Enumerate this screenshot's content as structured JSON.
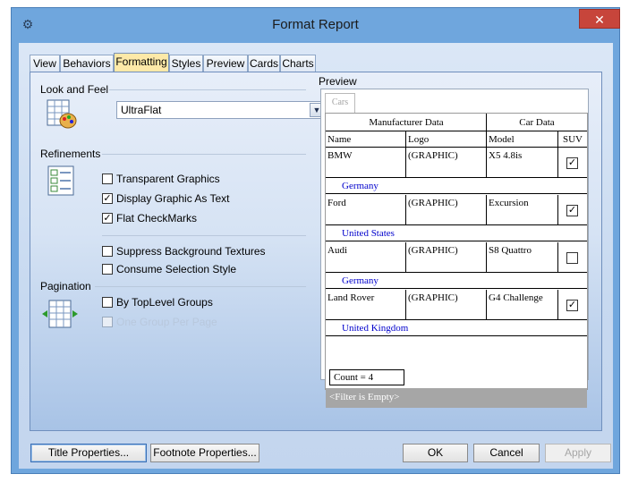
{
  "window": {
    "title": "Format Report",
    "close_glyph": "✕"
  },
  "tabs": [
    {
      "label": "View"
    },
    {
      "label": "Behaviors"
    },
    {
      "label": "Formatting"
    },
    {
      "label": "Styles"
    },
    {
      "label": "Preview"
    },
    {
      "label": "Cards"
    },
    {
      "label": "Charts"
    }
  ],
  "look_and_feel": {
    "heading": "Look and Feel",
    "combo_value": "UltraFlat",
    "icon": "palette-grid-icon"
  },
  "refinements": {
    "heading": "Refinements",
    "icon": "grid-checkboxes-icon",
    "options": [
      {
        "label": "Transparent Graphics",
        "checked": false
      },
      {
        "label": "Display Graphic As Text",
        "checked": true
      },
      {
        "label": "Flat CheckMarks",
        "checked": true
      },
      {
        "label": "Suppress Background Textures",
        "checked": false
      },
      {
        "label": "Consume Selection Style",
        "checked": false
      }
    ]
  },
  "pagination": {
    "heading": "Pagination",
    "icon": "page-grid-arrows-icon",
    "options": [
      {
        "label": "By TopLevel Groups",
        "checked": false,
        "enabled": true
      },
      {
        "label": "One Group Per Page",
        "checked": false,
        "enabled": false
      }
    ]
  },
  "preview": {
    "heading": "Preview",
    "grid_tab": "Cars",
    "bands": [
      "Manufacturer Data",
      "Car Data"
    ],
    "columns": [
      "Name",
      "Logo",
      "Model",
      "SUV"
    ],
    "rows": [
      {
        "name": "BMW",
        "logo": "(GRAPHIC)",
        "model": "X5 4.8is",
        "suv": true,
        "group": "Germany"
      },
      {
        "name": "Ford",
        "logo": "(GRAPHIC)",
        "model": "Excursion",
        "suv": true,
        "group": "United States"
      },
      {
        "name": "Audi",
        "logo": "(GRAPHIC)",
        "model": "S8 Quattro",
        "suv": false,
        "group": "Germany"
      },
      {
        "name": "Land Rover",
        "logo": "(GRAPHIC)",
        "model": "G4 Challenge",
        "suv": true,
        "group": "United Kingdom"
      }
    ],
    "count": "Count = 4",
    "filter": "<Filter is Empty>"
  },
  "buttons": {
    "title_properties": "Title Properties...",
    "footnote_properties": "Footnote Properties...",
    "ok": "OK",
    "cancel": "Cancel",
    "apply": "Apply"
  },
  "colors": {
    "window_frame": "#6fa6dd",
    "active_tab": "#fde9a8",
    "group_text": "#0000cc",
    "close_button": "#c7453b"
  }
}
